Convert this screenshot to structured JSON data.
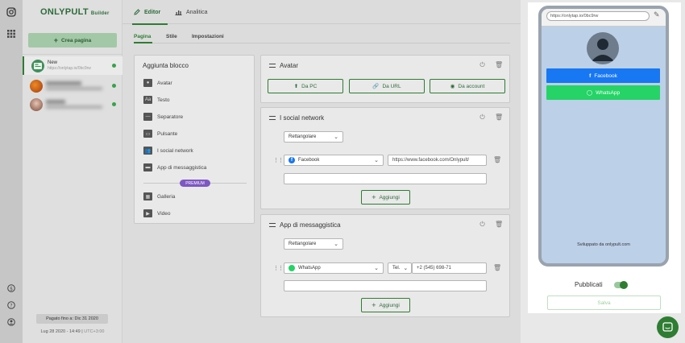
{
  "brand": {
    "name": "ONLYPULT",
    "suffix": "Builder"
  },
  "sidebar": {
    "create_label": "Crea pagina",
    "pages": [
      {
        "name": "New",
        "url": "https://onlytap.io/0bc9rw",
        "active": true
      },
      {
        "name": "",
        "url": "",
        "active": false
      },
      {
        "name": "",
        "url": "",
        "active": false
      }
    ],
    "paid_until": "Pagato fino a: Dic 31 2020",
    "datetime": "Lug 28 2020 - 14:49",
    "separator": "|",
    "timezone": "UTC+3:00"
  },
  "tabs": [
    {
      "label": "Editor",
      "icon": "pencil-icon"
    },
    {
      "label": "Analitica",
      "icon": "chart-icon"
    }
  ],
  "subtabs": [
    "Pagina",
    "Stile",
    "Impostazioni"
  ],
  "blocks_panel": {
    "title": "Aggiunta blocco",
    "items": [
      {
        "label": "Avatar",
        "icon": "avatar-icon"
      },
      {
        "label": "Testo",
        "icon": "text-icon"
      },
      {
        "label": "Separatore",
        "icon": "separator-icon"
      },
      {
        "label": "Pulsante",
        "icon": "button-icon"
      },
      {
        "label": "I social network",
        "icon": "people-icon"
      },
      {
        "label": "App di messaggistica",
        "icon": "message-icon"
      }
    ],
    "premium_badge": "PREMIUM",
    "premium_items": [
      {
        "label": "Galleria",
        "icon": "gallery-icon"
      },
      {
        "label": "Video",
        "icon": "video-icon"
      }
    ]
  },
  "avatar_card": {
    "title": "Avatar",
    "buttons": [
      "Da PC",
      "Da URL",
      "Da account"
    ]
  },
  "social_card": {
    "title": "I social network",
    "style": "Rettangolare",
    "network": "Facebook",
    "url_value": "https://www.facebook.com/Onlypult/",
    "text_value": "",
    "add_label": "Aggiungi"
  },
  "messenger_card": {
    "title": "App di messaggistica",
    "style": "Rettangolare",
    "app": "WhatsApp",
    "phone_type": "Tel.",
    "phone_value": "+2 (545) 698-71",
    "text_value": "",
    "add_label": "Aggiungi"
  },
  "preview": {
    "url": "https://onlytap.io/0bc9rw",
    "buttons": [
      {
        "label": "Facebook",
        "color": "#1877f2"
      },
      {
        "label": "WhatsApp",
        "color": "#25d366"
      }
    ],
    "powered_by": "Sviluppato da onlypult.com",
    "publish_label": "Pubblicati",
    "published": true,
    "save_label": "Salva"
  },
  "colors": {
    "accent": "#2e7d32",
    "premium": "#7e57c2"
  }
}
